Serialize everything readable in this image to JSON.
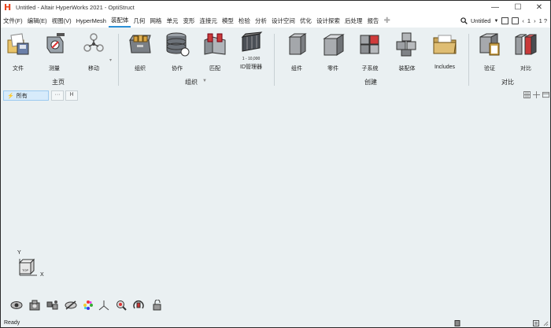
{
  "titlebar": {
    "title": "Untitled - Altair HyperWorks 2021 - OptiStruct",
    "logo_letter": "H",
    "minimize": "—",
    "maximize": "☐",
    "close": "✕"
  },
  "menubar": {
    "items": [
      "文件(F)",
      "编辑(E)",
      "视图(V)",
      "HyperMesh",
      "装配体",
      "几何",
      "网格",
      "单元",
      "变形",
      "连接元",
      "模型",
      "检验",
      "分析",
      "设计空间",
      "优化",
      "设计探索",
      "后处理",
      "报告"
    ],
    "active": "装配体",
    "model_name": "Untitled",
    "page_indicator": "1",
    "page_counter": "1 ?"
  },
  "ribbon": {
    "tools": [
      {
        "label": "文件",
        "icon": "file-icon"
      },
      {
        "label": "测量",
        "icon": "measure-icon"
      },
      {
        "label": "移动",
        "icon": "move-icon"
      },
      {
        "label": "组织",
        "icon": "organize-icon"
      },
      {
        "label": "协作",
        "icon": "collaborate-icon"
      },
      {
        "label": "匹配",
        "icon": "match-icon"
      },
      {
        "label": "ID管理器",
        "icon": "id-manager-icon"
      },
      {
        "label": "组件",
        "icon": "component-icon"
      },
      {
        "label": "零件",
        "icon": "part-icon"
      },
      {
        "label": "子系统",
        "icon": "subsystem-icon"
      },
      {
        "label": "装配体",
        "icon": "assembly-icon"
      },
      {
        "label": "Includes",
        "icon": "includes-folder-icon"
      },
      {
        "label": "验证",
        "icon": "validate-icon"
      },
      {
        "label": "对比",
        "icon": "compare-icon"
      }
    ],
    "groups": {
      "home": "主页",
      "organize": "组织",
      "create": "创建",
      "compare": "对比"
    },
    "id_manager_text": "1 - 10,000"
  },
  "tabstrip": {
    "all_label": "所有",
    "more": "···",
    "pin": "H"
  },
  "triad": {
    "y": "Y",
    "x": "X",
    "cube": "TOP"
  },
  "status": {
    "text": "Ready"
  }
}
